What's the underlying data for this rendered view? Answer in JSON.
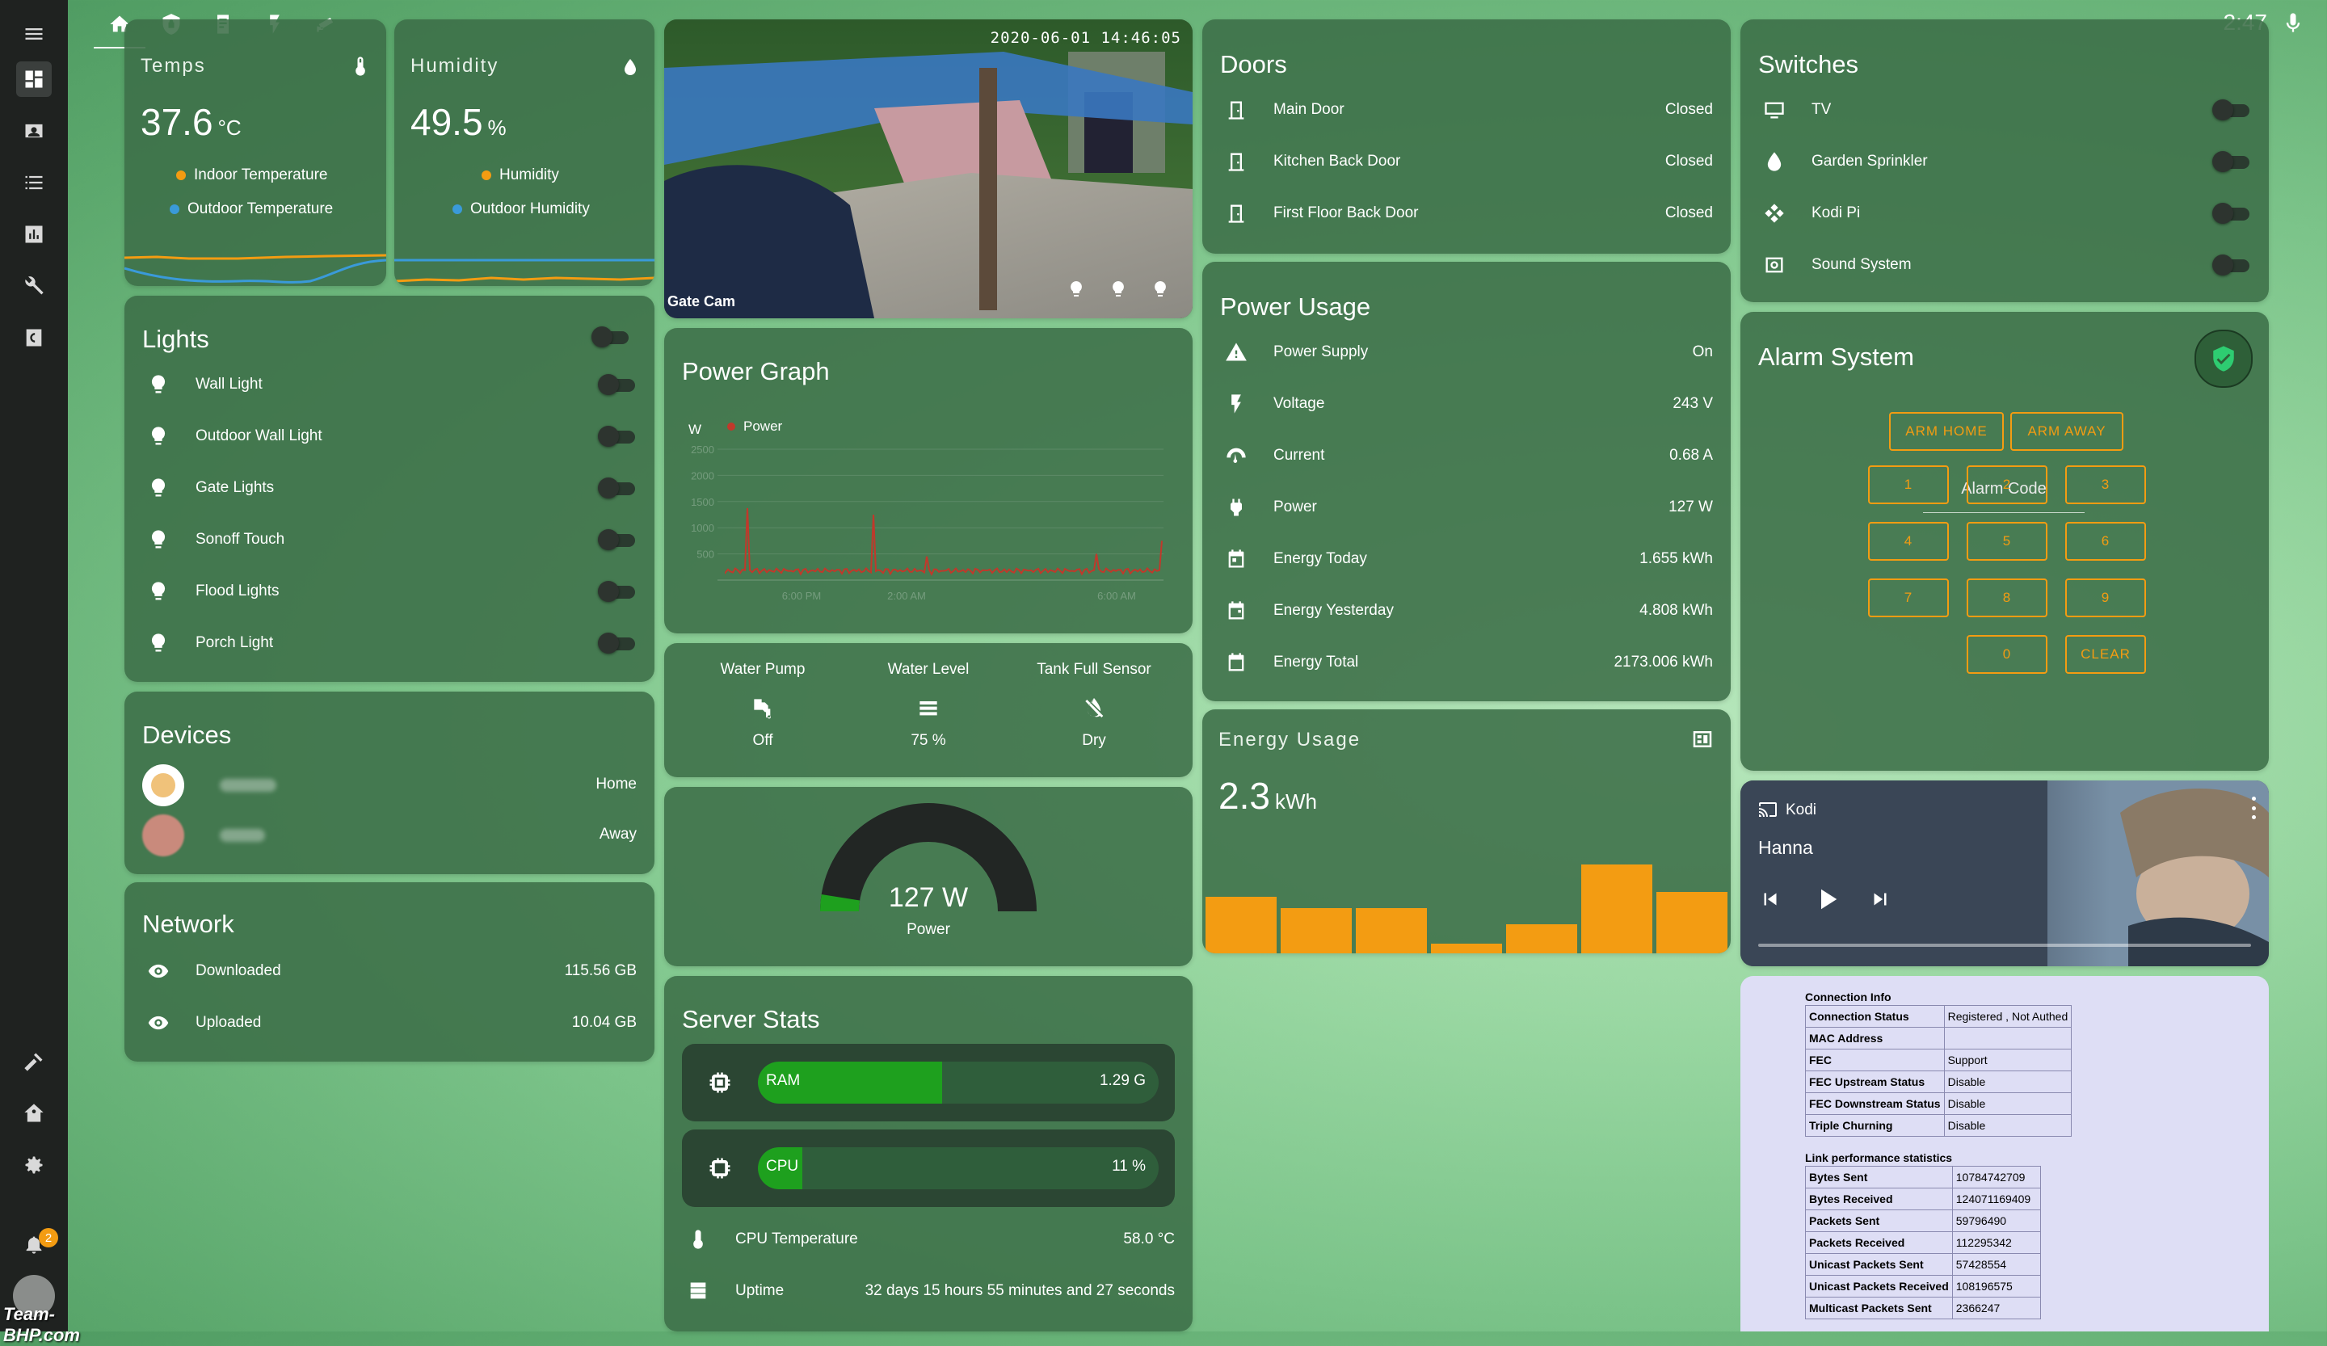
{
  "header": {
    "clock": "2:47"
  },
  "temps": {
    "name": "Temps",
    "value": "37.6",
    "unit": "°C",
    "legend": [
      "Indoor Temperature",
      "Outdoor Temperature"
    ]
  },
  "humidity": {
    "name": "Humidity",
    "value": "49.5",
    "unit": "%",
    "legend": [
      "Humidity",
      "Outdoor Humidity"
    ]
  },
  "camera": {
    "timestamp": "2020-06-01 14:46:05",
    "label": "Gate Cam"
  },
  "lights": {
    "title": "Lights",
    "items": [
      {
        "label": "Wall Light"
      },
      {
        "label": "Outdoor Wall Light"
      },
      {
        "label": "Gate Lights"
      },
      {
        "label": "Sonoff Touch"
      },
      {
        "label": "Flood Lights"
      },
      {
        "label": "Porch Light"
      }
    ]
  },
  "devices": {
    "title": "Devices",
    "items": [
      {
        "state": "Home"
      },
      {
        "state": "Away"
      }
    ]
  },
  "network": {
    "title": "Network",
    "items": [
      {
        "label": "Downloaded",
        "value": "115.56 GB"
      },
      {
        "label": "Uploaded",
        "value": "10.04 GB"
      }
    ]
  },
  "power_graph": {
    "title": "Power Graph",
    "unit": "W",
    "series_name": "Power",
    "y_ticks": [
      "2500",
      "2000",
      "1500",
      "1000",
      "500"
    ],
    "x_ticks": [
      "6:00 PM",
      "2:00 AM",
      "",
      "6:00 AM"
    ]
  },
  "water": {
    "items": [
      {
        "label": "Water Pump",
        "value": "Off"
      },
      {
        "label": "Water Level",
        "value": "75 %"
      },
      {
        "label": "Tank Full Sensor",
        "value": "Dry"
      }
    ]
  },
  "gauge": {
    "value_text": "127 W",
    "label": "Power",
    "fraction": 0.05
  },
  "server": {
    "title": "Server Stats",
    "ram": {
      "label": "RAM",
      "value": "1.29 G",
      "fraction": 0.46
    },
    "cpu": {
      "label": "CPU",
      "value": "11 %",
      "fraction": 0.11
    },
    "rows": [
      {
        "label": "CPU Temperature",
        "value": "58.0 °C"
      },
      {
        "label": "Uptime",
        "value": "32 days 15 hours 55 minutes and 27 seconds"
      }
    ]
  },
  "doors": {
    "title": "Doors",
    "items": [
      {
        "label": "Main Door",
        "value": "Closed"
      },
      {
        "label": "Kitchen Back Door",
        "value": "Closed"
      },
      {
        "label": "First Floor Back Door",
        "value": "Closed"
      }
    ]
  },
  "power_usage": {
    "title": "Power Usage",
    "items": [
      {
        "label": "Power Supply",
        "value": "On"
      },
      {
        "label": "Voltage",
        "value": "243 V"
      },
      {
        "label": "Current",
        "value": "0.68 A"
      },
      {
        "label": "Power",
        "value": "127 W"
      },
      {
        "label": "Energy Today",
        "value": "1.655 kWh"
      },
      {
        "label": "Energy Yesterday",
        "value": "4.808 kWh"
      },
      {
        "label": "Energy Total",
        "value": "2173.006 kWh"
      }
    ]
  },
  "energy": {
    "title": "Energy Usage",
    "value": "2.3",
    "unit": "kWh"
  },
  "switches": {
    "title": "Switches",
    "items": [
      {
        "label": "TV"
      },
      {
        "label": "Garden Sprinkler"
      },
      {
        "label": "Kodi Pi"
      },
      {
        "label": "Sound System"
      }
    ]
  },
  "alarm": {
    "title": "Alarm System",
    "arm_home": "ARM HOME",
    "arm_away": "ARM AWAY",
    "code_label": "Alarm Code",
    "keys": [
      "1",
      "2",
      "3",
      "4",
      "5",
      "6",
      "7",
      "8",
      "9",
      "0",
      "CLEAR"
    ]
  },
  "kodi": {
    "source": "Kodi",
    "title": "Hanna"
  },
  "connection": {
    "title": "Connection Info",
    "rows": [
      {
        "k": "Connection Status",
        "v": "Registered , Not Authed"
      },
      {
        "k": "MAC Address",
        "v": ""
      },
      {
        "k": "FEC",
        "v": "Support"
      },
      {
        "k": "FEC Upstream Status",
        "v": "Disable"
      },
      {
        "k": "FEC Downstream Status",
        "v": "Disable"
      },
      {
        "k": "Triple Churning",
        "v": "Disable"
      }
    ],
    "stats_title": "Link performance statistics",
    "stats": [
      {
        "k": "Bytes Sent",
        "v": "10784742709"
      },
      {
        "k": "Bytes Received",
        "v": "124071169409"
      },
      {
        "k": "Packets Sent",
        "v": "59796490"
      },
      {
        "k": "Packets Received",
        "v": "112295342"
      },
      {
        "k": "Unicast Packets Sent",
        "v": "57428554"
      },
      {
        "k": "Unicast Packets Received",
        "v": "108196575"
      },
      {
        "k": "Multicast Packets Sent",
        "v": "2366247"
      }
    ]
  },
  "notifications": {
    "count": "2"
  },
  "watermark": {
    "text": "Team-BHP.com"
  },
  "colors": {
    "accent": "#f39c12",
    "card": "#3c6e48",
    "bar_green": "#1ea01e"
  }
}
